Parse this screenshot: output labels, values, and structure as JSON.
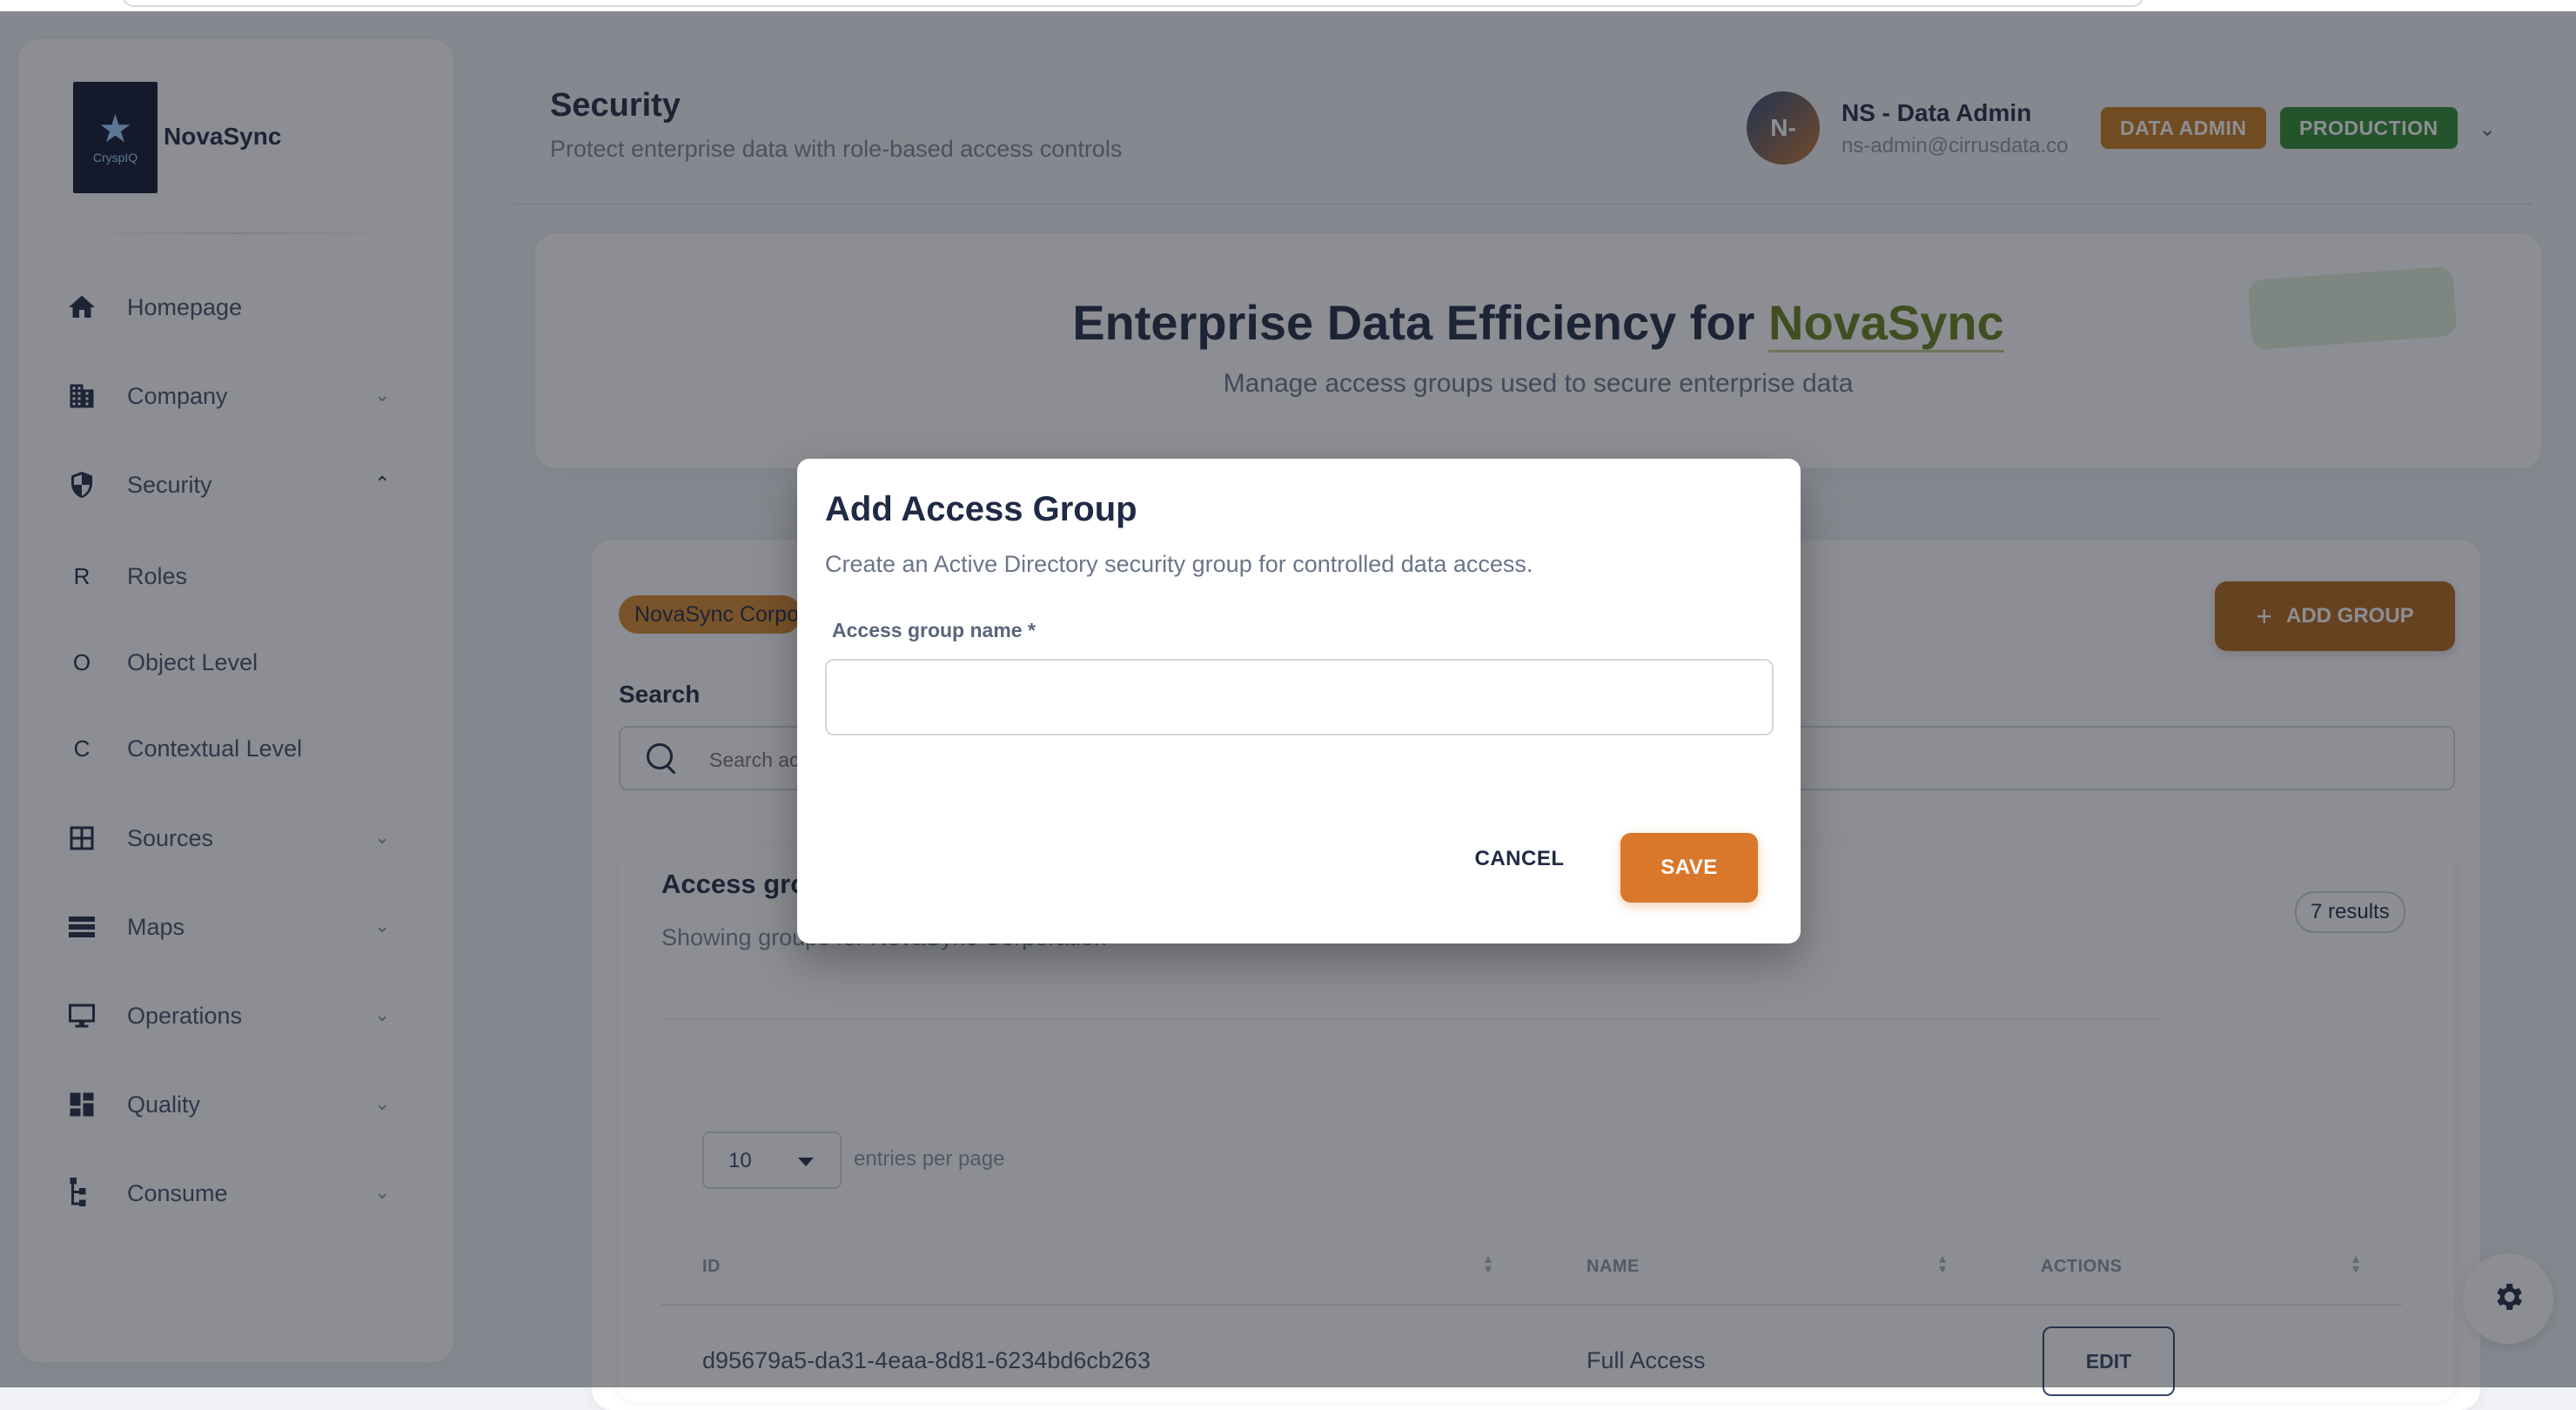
{
  "sidebar": {
    "brand": "NovaSync",
    "logo_text": "CryspIQ",
    "items": [
      {
        "label": "Homepage",
        "icon": "home-icon"
      },
      {
        "label": "Company",
        "icon": "building-icon"
      },
      {
        "label": "Security",
        "icon": "shield-icon"
      },
      {
        "label": "Roles",
        "icon": "R"
      },
      {
        "label": "Object Level",
        "icon": "O"
      },
      {
        "label": "Contextual Level",
        "icon": "C"
      },
      {
        "label": "Sources",
        "icon": "grid-icon"
      },
      {
        "label": "Maps",
        "icon": "list-icon"
      },
      {
        "label": "Operations",
        "icon": "monitor-icon"
      },
      {
        "label": "Quality",
        "icon": "dashboard-icon"
      },
      {
        "label": "Consume",
        "icon": "hierarchy-icon"
      }
    ]
  },
  "header": {
    "title": "Security",
    "subtitle": "Protect enterprise data with role-based access controls",
    "avatar_initials": "N-",
    "user_name": "NS - Data Admin",
    "user_email": "ns-admin@cirrusdata.co",
    "badge_role": "DATA ADMIN",
    "badge_env": "PRODUCTION"
  },
  "hero": {
    "title_prefix": "Enterprise Data Efficiency for ",
    "title_accent": "NovaSync",
    "subtitle": "Manage access groups used to secure enterprise data"
  },
  "main": {
    "org_chip": "NovaSync Corporation",
    "add_group_label": "ADD GROUP",
    "search_label": "Search",
    "search_placeholder": "Search access groups",
    "card_title": "Access groups",
    "card_subtitle": "Showing groups for NovaSync Corporation",
    "results": "7 results",
    "entries_value": "10",
    "entries_label": "entries per page",
    "columns": [
      "ID",
      "NAME",
      "ACTIONS"
    ],
    "rows": [
      {
        "id": "d95679a5-da31-4eaa-8d81-6234bd6cb263",
        "name": "Full Access",
        "action": "EDIT"
      }
    ]
  },
  "modal": {
    "title": "Add Access Group",
    "description": "Create an Active Directory security group for controlled data access.",
    "field_label": "Access group name *",
    "field_value": "",
    "cancel_label": "CANCEL",
    "save_label": "SAVE"
  },
  "colors": {
    "accent_orange": "#d9772a",
    "badge_admin": "#c97a1c",
    "badge_prod": "#2f8a2f",
    "brand_green": "#6b7d1a"
  }
}
